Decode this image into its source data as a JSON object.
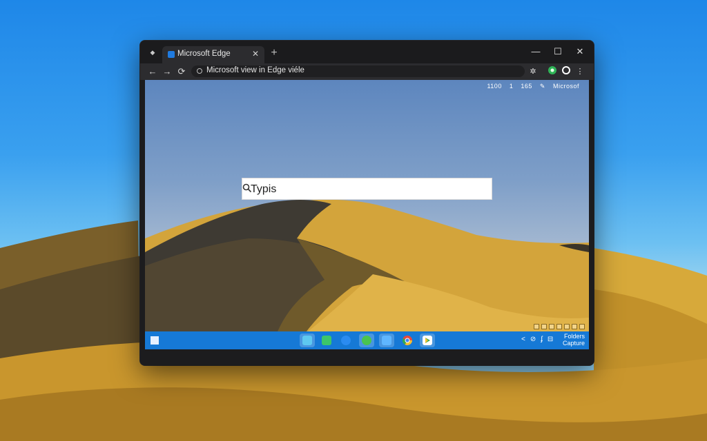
{
  "browser": {
    "tab": {
      "title": "Microsoft Edge",
      "favicon": "edge-icon"
    },
    "newtab_label": "+",
    "window_controls": {
      "minimize": "—",
      "maximize": "☐",
      "close": "✕"
    },
    "nav": {
      "back": "←",
      "forward": "→",
      "refresh": "⟳"
    },
    "url": "Microsoft view in Edge viéle",
    "toolbar_icons": [
      "favorites-icon",
      "extension-icon",
      "copilot-icon",
      "more-icon"
    ]
  },
  "page": {
    "top_info": [
      "1100",
      "1",
      "165",
      "Microsof"
    ],
    "search": {
      "value": "Typis",
      "icon": "search-icon"
    }
  },
  "taskbar": {
    "apps": [
      {
        "name": "chat",
        "color": "#5ec8f0"
      },
      {
        "name": "messages",
        "color": "#3cc66a"
      },
      {
        "name": "xbox",
        "color": "#2a8bf0"
      },
      {
        "name": "whatsapp",
        "color": "#49c44f"
      },
      {
        "name": "store",
        "color": "#5fb6ff"
      },
      {
        "name": "chrome",
        "color": "#e8493c"
      },
      {
        "name": "play-store",
        "color": "#f1c232"
      }
    ],
    "tray_icons": [
      "<",
      "⊘",
      "ʄ",
      "⊟"
    ],
    "clock": {
      "line1": "Folders",
      "line2": "Capture"
    }
  },
  "colors": {
    "accent": "#1679d6",
    "window": "#1c1c1e"
  }
}
